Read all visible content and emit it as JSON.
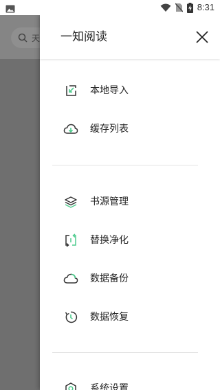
{
  "status_bar": {
    "time": "8:31",
    "icons": [
      "image-icon",
      "wifi-icon",
      "no-sim-icon",
      "battery-charging-icon"
    ]
  },
  "background": {
    "search_placeholder": "天"
  },
  "drawer": {
    "title": "一知阅读",
    "close_icon": "close-icon",
    "sections": [
      {
        "items": [
          {
            "label": "本地导入",
            "icon": "import-icon"
          },
          {
            "label": "缓存列表",
            "icon": "cloud-download-icon"
          }
        ]
      },
      {
        "items": [
          {
            "label": "书源管理",
            "icon": "layers-icon"
          },
          {
            "label": "替换净化",
            "icon": "swap-icon"
          },
          {
            "label": "数据备份",
            "icon": "cloud-backup-icon"
          },
          {
            "label": "数据恢复",
            "icon": "restore-icon"
          }
        ]
      },
      {
        "items": [
          {
            "label": "系统设置",
            "icon": "settings-icon"
          }
        ]
      }
    ]
  },
  "colors": {
    "accent": "#4ecb8d",
    "icon_stroke": "#333333",
    "scrim": "#7a7a7a"
  }
}
